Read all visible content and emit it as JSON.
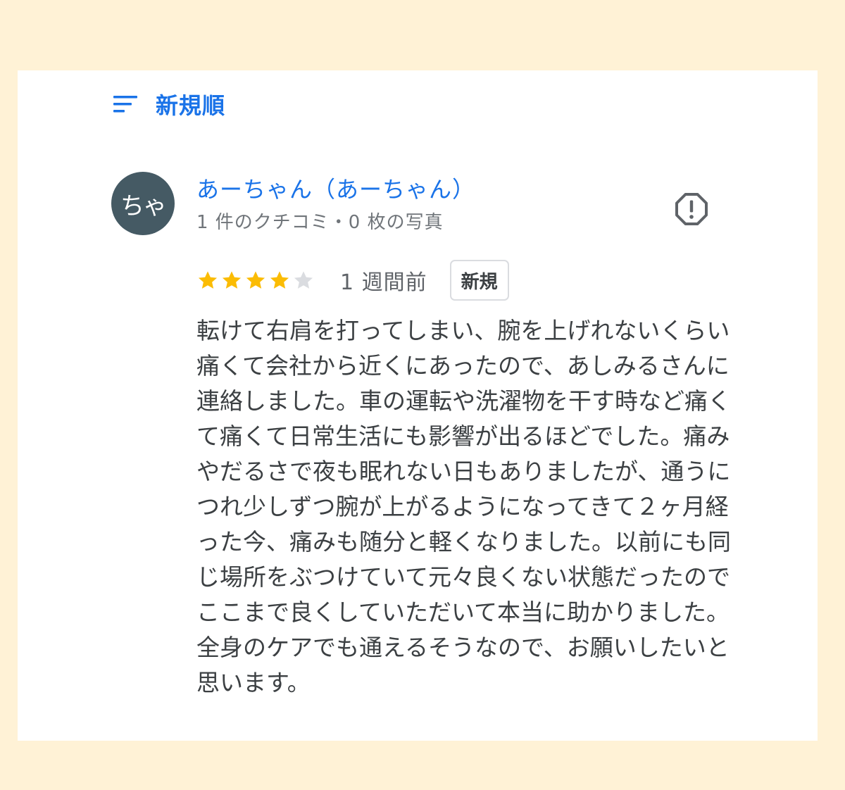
{
  "sort": {
    "label": "新規順",
    "icon": "sort-icon"
  },
  "review": {
    "avatar_text": "ちゃ",
    "avatar_color": "#455a64",
    "reviewer_name": "あーちゃん（あーちゃん）",
    "reviewer_meta": "1 件のクチコミ・0 枚の写真",
    "report_icon": "report-icon",
    "rating": 4,
    "rating_max": 5,
    "date": "1 週間前",
    "badge": "新規",
    "text": "転けて右肩を打ってしまい、腕を上げれないくらい痛くて会社から近くにあったので、あしみるさんに連絡しました。車の運転や洗濯物を干す時など痛くて痛くて日常生活にも影響が出るほどでした。痛みやだるさで夜も眠れない日もありましたが、通うにつれ少しずつ腕が上がるようになってきて２ヶ月経った今、痛みも随分と軽くなりました。以前にも同じ場所をぶつけていて元々良くない状態だったのでここまで良くしていただいて本当に助かりました。全身のケアでも通えるそうなので、お願いしたいと思います。"
  },
  "colors": {
    "background": "#fff2d6",
    "card": "#ffffff",
    "link_blue": "#1a73e8",
    "star_filled": "#fbbc04",
    "star_empty": "#dadce0",
    "text": "#3c4043",
    "meta_text": "#70757a"
  }
}
